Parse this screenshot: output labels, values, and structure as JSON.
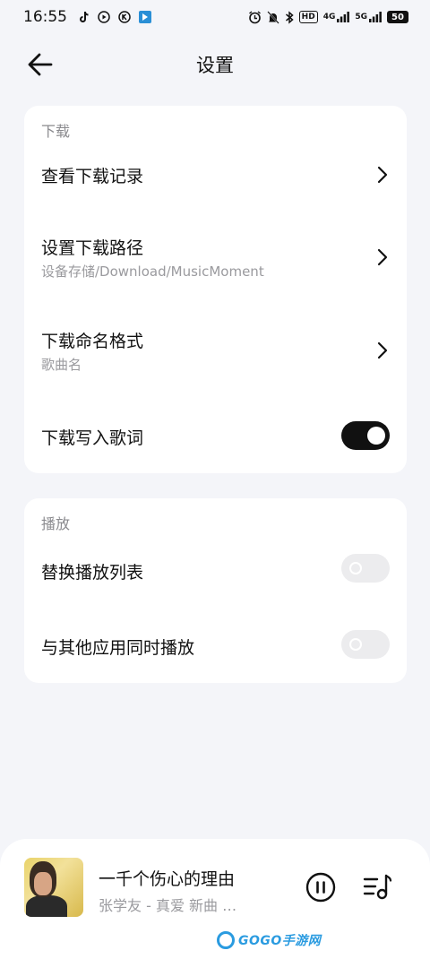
{
  "status_bar": {
    "time": "16:55",
    "signal_1": "4G",
    "signal_2": "5G",
    "hd_label": "HD",
    "battery": "50"
  },
  "header": {
    "title": "设置"
  },
  "download_section": {
    "label": "下载",
    "rows": [
      {
        "title": "查看下载记录"
      },
      {
        "title": "设置下载路径",
        "subtitle": "设备存储/Download/MusicMoment"
      },
      {
        "title": "下载命名格式",
        "subtitle": "歌曲名"
      },
      {
        "title": "下载写入歌词",
        "toggle": true
      }
    ]
  },
  "play_section": {
    "label": "播放",
    "rows": [
      {
        "title": "替换播放列表",
        "toggle": false
      },
      {
        "title": "与其他应用同时播放",
        "toggle": false
      }
    ]
  },
  "player": {
    "song_title": "一千个伤心的理由",
    "meta": "张学友 - 真爱 新曲 …"
  },
  "watermark": {
    "text": "GOGO手游网"
  },
  "colors": {
    "background": "#f4f5f9",
    "card": "#ffffff",
    "toggle_on": "#111111",
    "toggle_off": "#ececee"
  }
}
